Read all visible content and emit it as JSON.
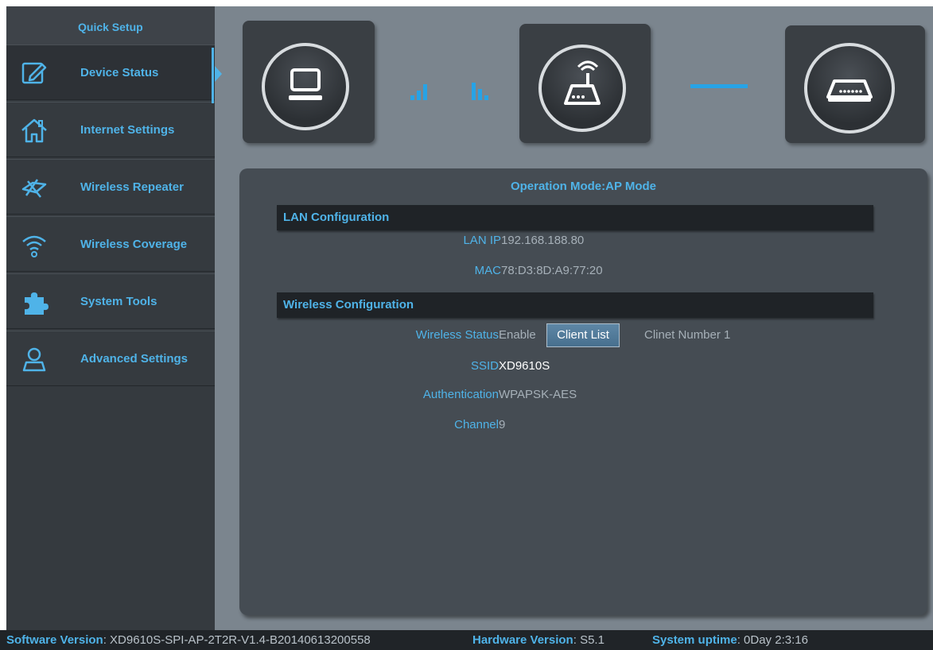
{
  "sidebar": {
    "quick_setup": "Quick Setup",
    "items": [
      {
        "label": "Device Status",
        "icon": "edit-icon"
      },
      {
        "label": "Internet Settings",
        "icon": "home-icon"
      },
      {
        "label": "Wireless Repeater",
        "icon": "repeater-icon"
      },
      {
        "label": "Wireless Coverage",
        "icon": "wifi-icon"
      },
      {
        "label": "System Tools",
        "icon": "puzzle-icon"
      },
      {
        "label": "Advanced Settings",
        "icon": "user-icon"
      }
    ],
    "active_index": 0
  },
  "topology": {
    "devices": [
      "computer-icon",
      "router-icon",
      "modem-icon"
    ],
    "accent_color": "#27a3e6"
  },
  "status": {
    "operation_mode_label": "Operation Mode:",
    "operation_mode_value": "AP Mode",
    "lan": {
      "title": "LAN Configuration",
      "ip_label": "LAN IP",
      "ip_value": "192.168.188.80",
      "mac_label": "MAC",
      "mac_value": "78:D3:8D:A9:77:20"
    },
    "wireless": {
      "title": "Wireless Configuration",
      "status_label": "Wireless Status",
      "status_value": "Enable",
      "client_list_button": "Client List",
      "client_number": "Clinet Number 1",
      "ssid_label": "SSID",
      "ssid_value": "XD9610S",
      "auth_label": "Authentication",
      "auth_value": "WPAPSK-AES",
      "channel_label": "Channel",
      "channel_value": "9"
    }
  },
  "footer": {
    "software_label": "Software Version",
    "software_value": ": XD9610S-SPI-AP-2T2R-V1.4-B20140613200558",
    "hardware_label": "Hardware Version",
    "hardware_value": ": S5.1",
    "uptime_label": "System uptime",
    "uptime_value": ": 0Day 2:3:16"
  }
}
